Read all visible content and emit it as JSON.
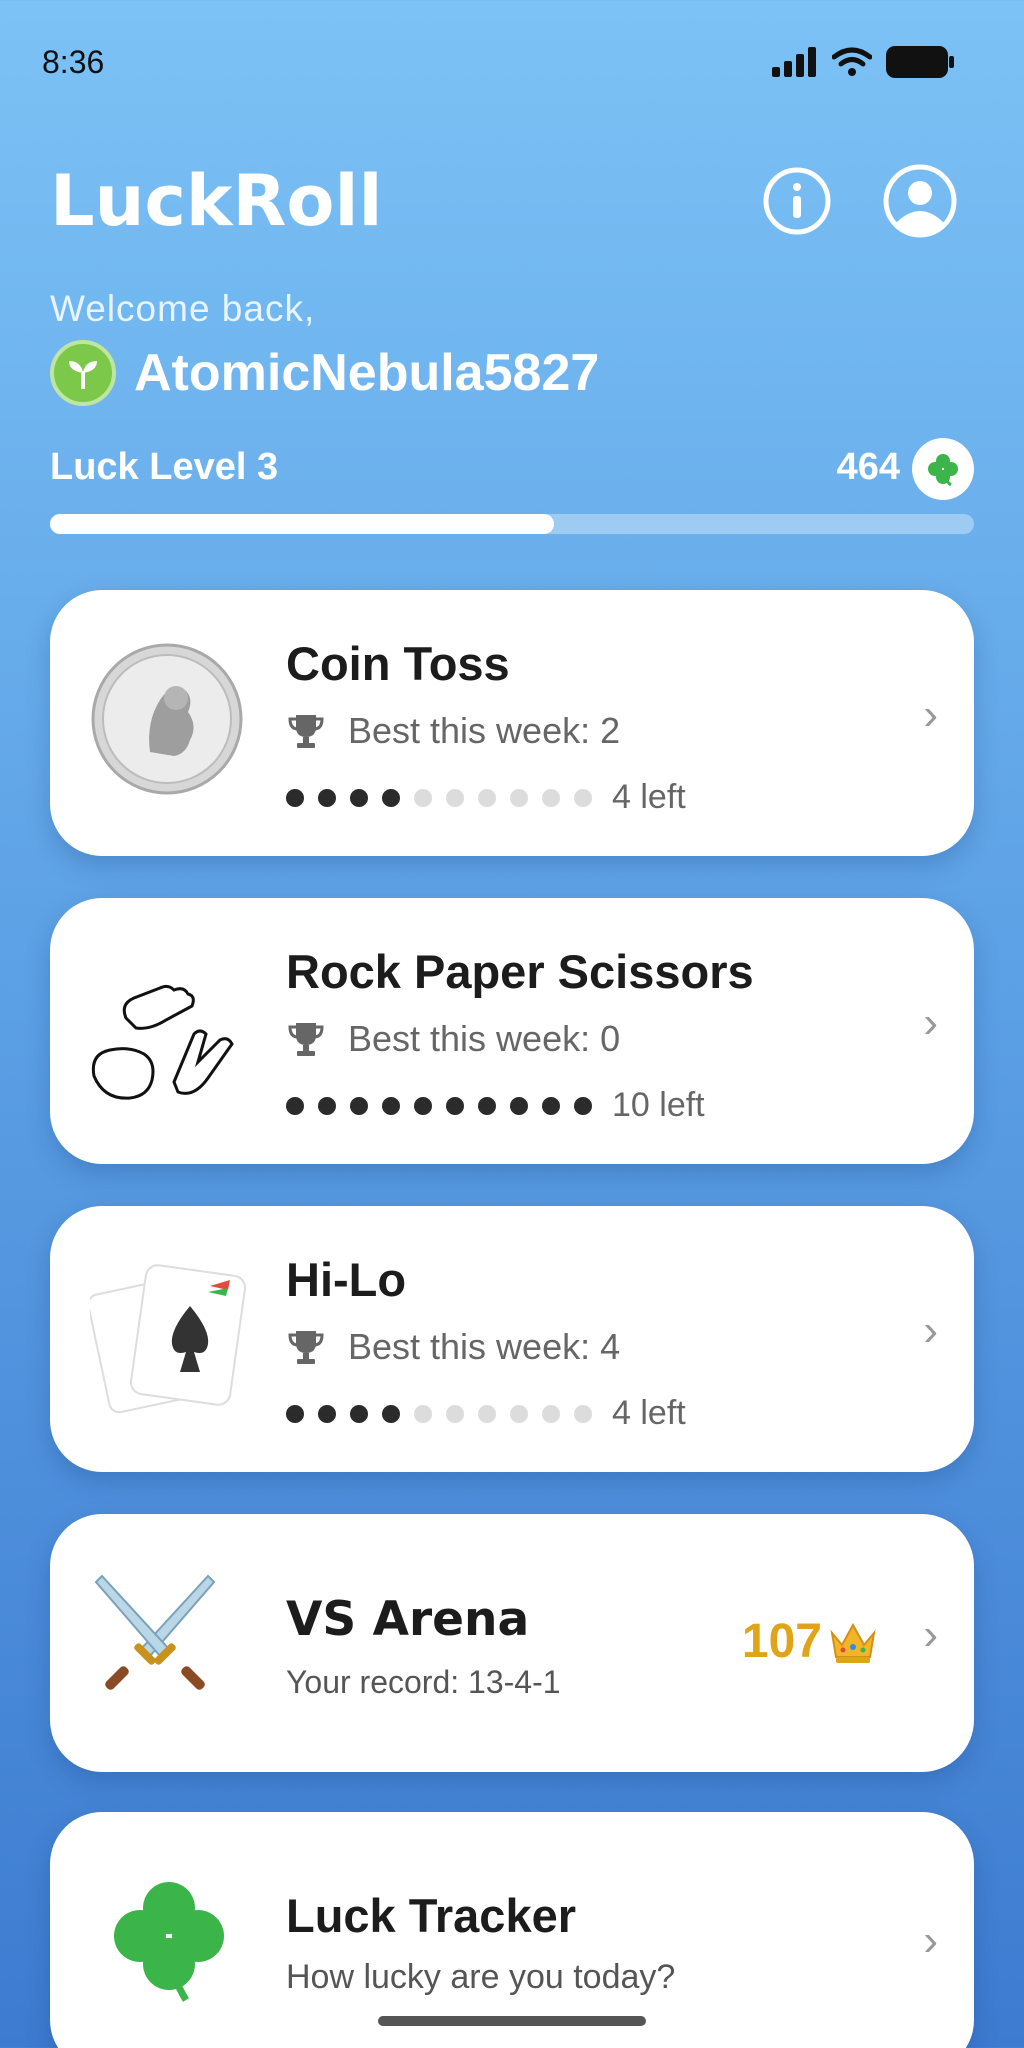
{
  "status": {
    "time": "8:36"
  },
  "header": {
    "title": "LuckRoll",
    "info_icon": "info-icon",
    "profile_icon": "user-profile-icon"
  },
  "user": {
    "welcome": "Welcome back,",
    "username": "AtomicNebula5827",
    "avatar_icon": "sprout-avatar-icon"
  },
  "luck": {
    "level_label": "Luck Level 3",
    "points": "464",
    "points_icon": "four-leaf-clover-icon",
    "progress": 0.545
  },
  "games": [
    {
      "title": "Coin Toss",
      "best": "Best this week: 2",
      "left": "4 left",
      "filled": 4,
      "total": 10,
      "icon": "coin-icon"
    },
    {
      "title": "Rock Paper Scissors",
      "best": "Best this week: 0",
      "left": "10 left",
      "filled": 10,
      "total": 10,
      "icon": "hands-icon"
    },
    {
      "title": "Hi-Lo",
      "best": "Best this week: 4",
      "left": "4 left",
      "filled": 4,
      "total": 10,
      "icon": "playing-cards-icon"
    }
  ],
  "vs_arena": {
    "title": "VS Arena",
    "record": "Your record: 13-4-1",
    "score": "107",
    "score_icon": "crown-icon",
    "icon": "crossed-swords-icon"
  },
  "luck_tracker": {
    "title": "Luck Tracker",
    "subtitle": "How lucky are you today?",
    "icon": "clover-icon"
  },
  "colors": {
    "accent_gold": "#e0a418",
    "clover_green": "#3bb54a",
    "text_dark": "#1c1c1c"
  }
}
